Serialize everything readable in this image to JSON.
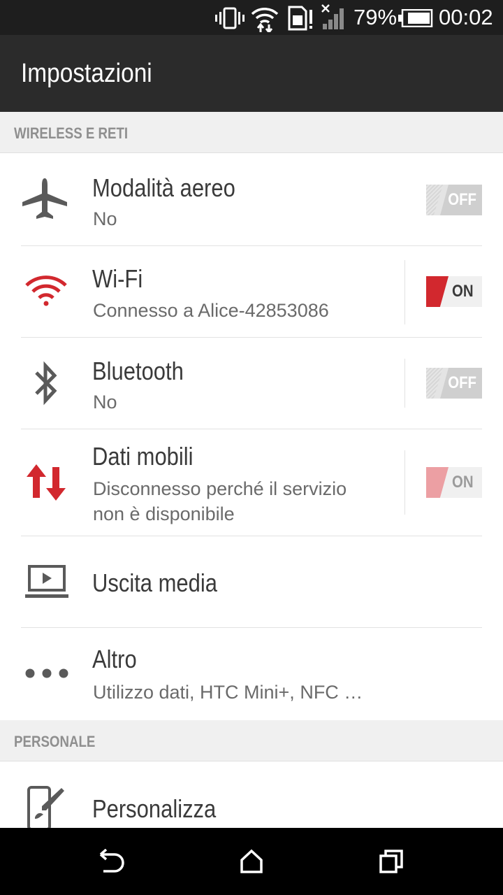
{
  "status_bar": {
    "battery_percent": "79%",
    "time": "00:02",
    "icons": [
      "vibrate-icon",
      "wifi-data-icon",
      "sim-alert-icon",
      "no-signal-icon",
      "battery-icon"
    ]
  },
  "app_bar": {
    "title": "Impostazioni"
  },
  "sections": {
    "wireless": {
      "header": "WIRELESS E RETI"
    },
    "personal": {
      "header": "PERSONALE"
    }
  },
  "items": {
    "airplane": {
      "title": "Modalità aereo",
      "subtitle": "No",
      "toggle": "OFF",
      "icon": "airplane-icon"
    },
    "wifi": {
      "title": "Wi-Fi",
      "subtitle": "Connesso a Alice-42853086",
      "toggle": "ON",
      "icon": "wifi-icon"
    },
    "bluetooth": {
      "title": "Bluetooth",
      "subtitle": "No",
      "toggle": "OFF",
      "icon": "bluetooth-icon"
    },
    "mobile_data": {
      "title": "Dati mobili",
      "subtitle_line1": "Disconnesso perché il servizio",
      "subtitle_line2": "non è disponibile",
      "toggle": "ON",
      "icon": "data-arrows-icon"
    },
    "media_output": {
      "title": "Uscita media",
      "icon": "media-output-icon"
    },
    "more": {
      "title": "Altro",
      "subtitle": "Utilizzo dati, HTC Mini+, NFC …",
      "icon": "more-dots-icon"
    },
    "personalize": {
      "title": "Personalizza",
      "icon": "personalize-icon"
    }
  },
  "colors": {
    "accent_red": "#d2282e",
    "accent_red_disabled": "#ec9fa3",
    "status_bar": "#1e1e1e",
    "app_bar": "#2b2b2b",
    "section_bg": "#f0f0f0"
  },
  "nav_bar": {
    "buttons": [
      "back-icon",
      "home-icon",
      "recents-icon"
    ]
  }
}
